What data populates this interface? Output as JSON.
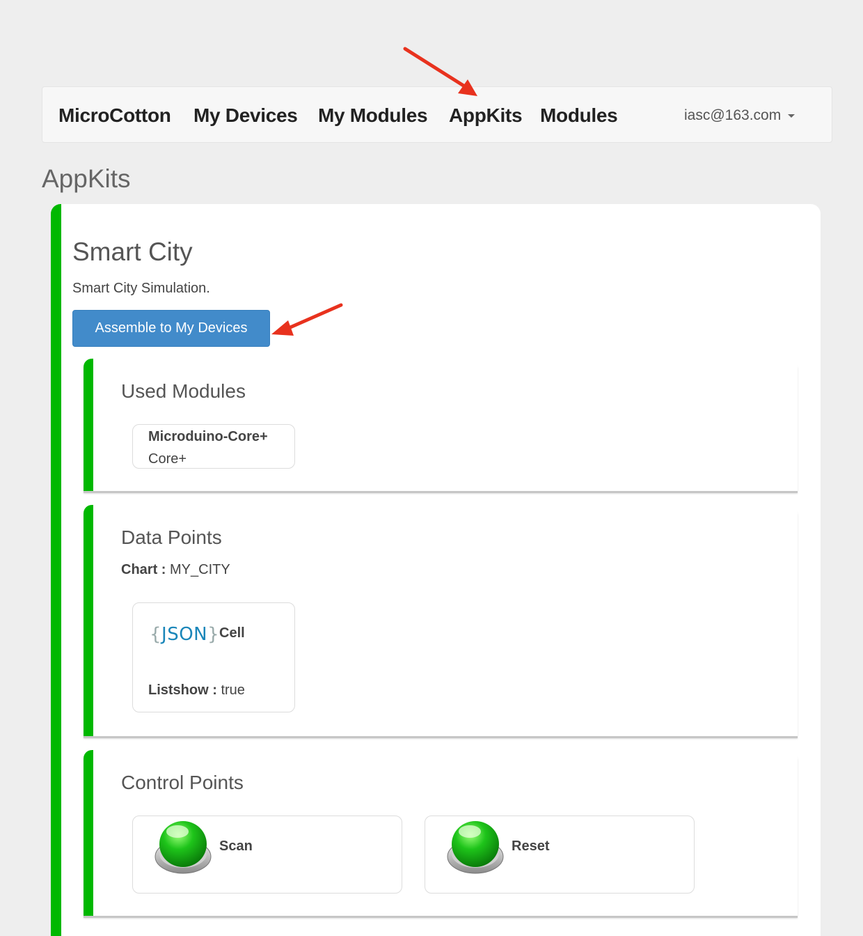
{
  "navbar": {
    "brand": "MicroCotton",
    "items": [
      {
        "label": "My Devices"
      },
      {
        "label": "My Modules"
      },
      {
        "label": "AppKits"
      },
      {
        "label": "Modules"
      }
    ],
    "user": "iasc@163.com"
  },
  "page": {
    "title": "AppKits"
  },
  "appkit": {
    "title": "Smart City",
    "description": "Smart City Simulation.",
    "assemble_label": "Assemble to My Devices",
    "used_modules": {
      "title": "Used Modules",
      "modules": [
        {
          "name": "Microduino-Core+",
          "sub": "Core+"
        }
      ]
    },
    "data_points": {
      "title": "Data Points",
      "chart_label": "Chart :",
      "chart_value": "MY_CITY",
      "cells": [
        {
          "icon_text": "JSON",
          "name": "Cell",
          "listshow_label": "Listshow :",
          "listshow_value": "true"
        }
      ]
    },
    "control_points": {
      "title": "Control Points",
      "controls": [
        {
          "label": "Scan"
        },
        {
          "label": "Reset"
        }
      ]
    }
  },
  "colors": {
    "accent_green": "#00b800",
    "primary_button": "#428bca",
    "annotation_arrow": "#e8321e"
  },
  "icons": {
    "green_button": "green-push-button-icon",
    "json": "json-icon",
    "caret": "caret-down-icon"
  }
}
